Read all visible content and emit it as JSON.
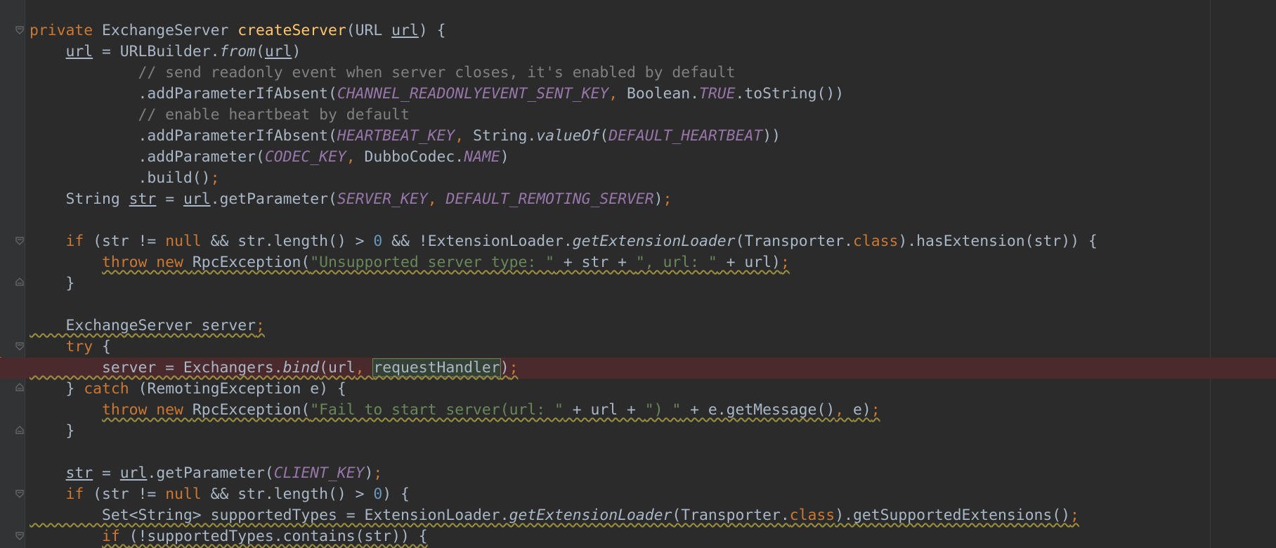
{
  "editor": {
    "language": "java",
    "lines": [
      {
        "tokens": [
          [
            "kw",
            "private "
          ],
          [
            "",
            "ExchangeServer "
          ],
          [
            "fn",
            "createServer"
          ],
          [
            "",
            "(URL "
          ],
          [
            "ul",
            "url"
          ],
          [
            "",
            ") {"
          ]
        ]
      },
      {
        "tokens": [
          [
            "",
            "    "
          ],
          [
            "ul",
            "url"
          ],
          [
            "",
            " = URLBuilder."
          ],
          [
            "static",
            "from"
          ],
          [
            "",
            "("
          ],
          [
            "ul",
            "url"
          ],
          [
            "",
            ")"
          ]
        ]
      },
      {
        "tokens": [
          [
            "",
            "            "
          ],
          [
            "cmt",
            "// send readonly event when server closes, it's enabled by default"
          ]
        ]
      },
      {
        "tokens": [
          [
            "",
            "            .addParameterIfAbsent("
          ],
          [
            "const",
            "CHANNEL_READONLYEVENT_SENT_KEY"
          ],
          [
            "kw",
            ", "
          ],
          [
            "",
            "Boolean."
          ],
          [
            "const",
            "TRUE"
          ],
          [
            "",
            ".toString())"
          ]
        ]
      },
      {
        "tokens": [
          [
            "",
            "            "
          ],
          [
            "cmt",
            "// enable heartbeat by default"
          ]
        ]
      },
      {
        "tokens": [
          [
            "",
            "            .addParameterIfAbsent("
          ],
          [
            "const",
            "HEARTBEAT_KEY"
          ],
          [
            "kw",
            ", "
          ],
          [
            "",
            "String."
          ],
          [
            "static",
            "valueOf"
          ],
          [
            "",
            "("
          ],
          [
            "const",
            "DEFAULT_HEARTBEAT"
          ],
          [
            "",
            "))"
          ]
        ]
      },
      {
        "tokens": [
          [
            "",
            "            .addParameter("
          ],
          [
            "const",
            "CODEC_KEY"
          ],
          [
            "kw",
            ", "
          ],
          [
            "",
            "DubboCodec."
          ],
          [
            "const",
            "NAME"
          ],
          [
            "",
            ")"
          ]
        ]
      },
      {
        "tokens": [
          [
            "",
            "            .build()"
          ],
          [
            "kw",
            ";"
          ]
        ]
      },
      {
        "tokens": [
          [
            "",
            "    String "
          ],
          [
            "ul",
            "str"
          ],
          [
            "",
            " = "
          ],
          [
            "ul",
            "url"
          ],
          [
            "",
            ".getParameter("
          ],
          [
            "const",
            "SERVER_KEY"
          ],
          [
            "kw",
            ", "
          ],
          [
            "const",
            "DEFAULT_REMOTING_SERVER"
          ],
          [
            "",
            ")"
          ],
          [
            "kw",
            ";"
          ]
        ]
      },
      {
        "tokens": [
          [
            "",
            ""
          ]
        ]
      },
      {
        "tokens": [
          [
            "",
            "    "
          ],
          [
            "kw",
            "if "
          ],
          [
            "",
            "(str != "
          ],
          [
            "kw",
            "null "
          ],
          [
            "",
            "&& str.length() > "
          ],
          [
            "num",
            "0"
          ],
          [
            "",
            " && !ExtensionLoader."
          ],
          [
            "static",
            "getExtensionLoader"
          ],
          [
            "",
            "(Transporter."
          ],
          [
            "kw",
            "class"
          ],
          [
            "",
            ").hasExtension(str)) {"
          ]
        ]
      },
      {
        "tokens": [
          [
            "",
            "        "
          ],
          [
            "kw",
            "throw new "
          ],
          [
            "",
            "RpcException("
          ],
          [
            "str",
            "\"Unsupported server type: \""
          ],
          [
            "",
            " + str + "
          ],
          [
            "str",
            "\", url: \""
          ],
          [
            "",
            " + url)"
          ],
          [
            "kw",
            ";"
          ]
        ]
      },
      {
        "tokens": [
          [
            "",
            "    }"
          ]
        ]
      },
      {
        "tokens": [
          [
            "",
            ""
          ]
        ]
      },
      {
        "tokens": [
          [
            "",
            "    ExchangeServer server"
          ],
          [
            "kw",
            ";"
          ]
        ]
      },
      {
        "tokens": [
          [
            "",
            "    "
          ],
          [
            "kw",
            "try "
          ],
          [
            "",
            "{"
          ]
        ]
      },
      {
        "tokens": [
          [
            "",
            "        server = Exchangers."
          ],
          [
            "static",
            "bind"
          ],
          [
            "",
            "(url"
          ],
          [
            "kw",
            ", "
          ],
          [
            "hl",
            "requestHandler"
          ],
          [
            "",
            ")"
          ],
          [
            "kw",
            ";"
          ]
        ],
        "error": true
      },
      {
        "tokens": [
          [
            "",
            "    } "
          ],
          [
            "kw",
            "catch "
          ],
          [
            "",
            "(RemotingException e) {"
          ]
        ]
      },
      {
        "tokens": [
          [
            "",
            "        "
          ],
          [
            "kw",
            "throw new "
          ],
          [
            "",
            "RpcException("
          ],
          [
            "str",
            "\"Fail to start server(url: \""
          ],
          [
            "",
            " + url + "
          ],
          [
            "str",
            "\") \""
          ],
          [
            "",
            " + e.getMessage()"
          ],
          [
            "kw",
            ", "
          ],
          [
            "",
            "e)"
          ],
          [
            "kw",
            ";"
          ]
        ]
      },
      {
        "tokens": [
          [
            "",
            "    }"
          ]
        ]
      },
      {
        "tokens": [
          [
            "",
            ""
          ]
        ]
      },
      {
        "tokens": [
          [
            "",
            "    "
          ],
          [
            "ul",
            "str"
          ],
          [
            "",
            " = "
          ],
          [
            "ul",
            "url"
          ],
          [
            "",
            ".getParameter("
          ],
          [
            "const",
            "CLIENT_KEY"
          ],
          [
            "",
            ")"
          ],
          [
            "kw",
            ";"
          ]
        ]
      },
      {
        "tokens": [
          [
            "",
            "    "
          ],
          [
            "kw",
            "if "
          ],
          [
            "",
            "(str != "
          ],
          [
            "kw",
            "null "
          ],
          [
            "",
            "&& str.length() > "
          ],
          [
            "num",
            "0"
          ],
          [
            "",
            ") {"
          ]
        ]
      },
      {
        "tokens": [
          [
            "",
            "        Set<String> supportedTypes = ExtensionLoader."
          ],
          [
            "static",
            "getExtensionLoader"
          ],
          [
            "",
            "(Transporter."
          ],
          [
            "kw",
            "class"
          ],
          [
            "",
            ").getSupportedExtensions()"
          ],
          [
            "kw",
            ";"
          ]
        ]
      },
      {
        "tokens": [
          [
            "",
            "        "
          ],
          [
            "kw",
            "if "
          ],
          [
            "",
            "(!supportedTypes.contains(str)) {"
          ]
        ]
      }
    ]
  },
  "colors": {
    "background": "#2b2b2b",
    "gutter": "#313335",
    "keyword": "#cc7832",
    "method_decl": "#ffc66d",
    "string": "#6a8759",
    "comment": "#808080",
    "constant": "#9876aa",
    "number": "#6897bb",
    "default": "#a9b7c6",
    "error_line": "#4a2a2c"
  },
  "gutter_icons": [
    "fold-icon",
    "fold-icon",
    "fold-icon",
    "fold-icon",
    "fold-icon",
    "fold-icon",
    "fold-icon",
    "fold-icon",
    "breakpoint-icon"
  ]
}
